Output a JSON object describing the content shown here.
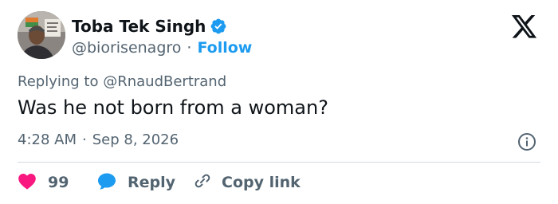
{
  "author": {
    "display_name": "Toba Tek Singh",
    "handle": "@biorisenagro",
    "separator": "·",
    "follow_label": "Follow"
  },
  "tweet": {
    "reply_prefix": "Replying to",
    "reply_to": "@RnaudBertrand",
    "text": "Was he not born from a woman?",
    "time": "4:28 AM",
    "meta_separator": "·",
    "date": "Sep 8, 2026"
  },
  "actions": {
    "like_count": "99",
    "reply_label": "Reply",
    "copy_label": "Copy link"
  },
  "icons": {
    "verified": "verified-badge-icon",
    "brand": "x-logo-icon",
    "info": "info-icon",
    "like": "heart-icon",
    "reply": "speech-bubble-icon",
    "copy": "link-icon"
  },
  "colors": {
    "text": "#0f1419",
    "secondary": "#536471",
    "accent": "#1d9bf0",
    "like": "#f91880",
    "divider": "#cfd9de"
  }
}
